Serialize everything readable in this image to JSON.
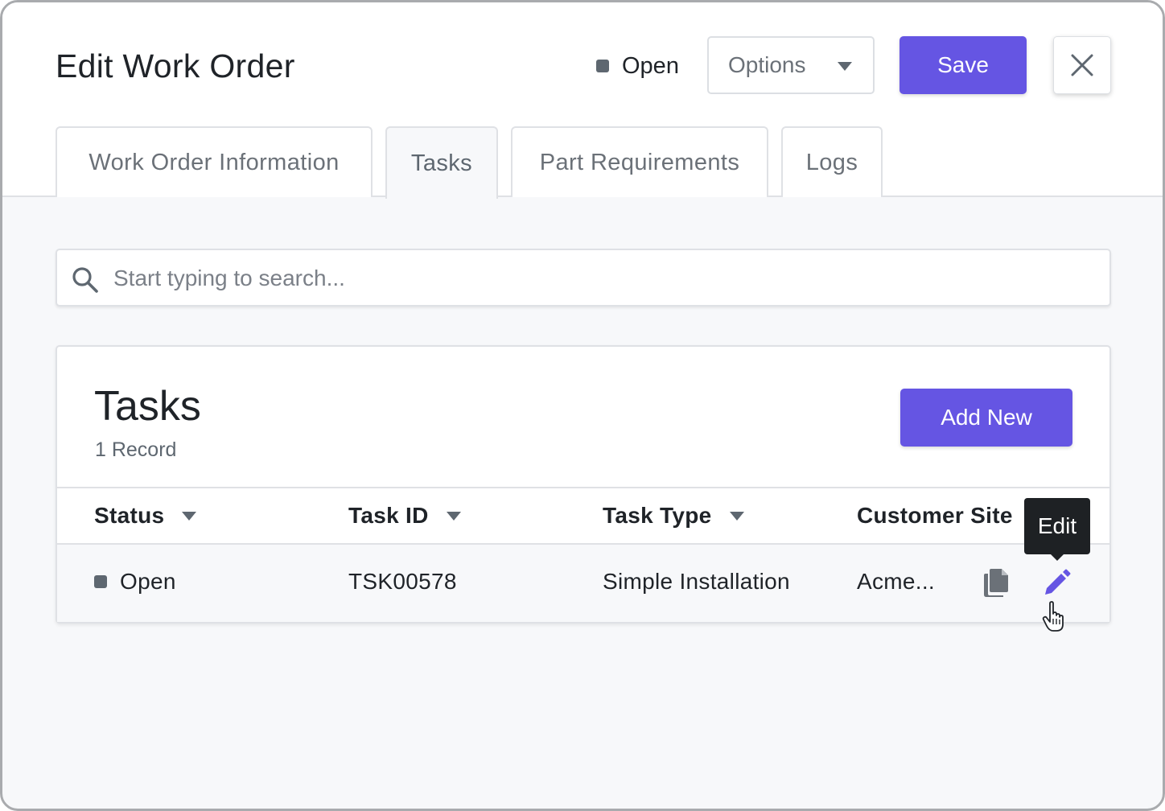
{
  "header": {
    "title": "Edit Work Order",
    "status": "Open",
    "options_label": "Options",
    "save_label": "Save"
  },
  "tabs": [
    {
      "label": "Work Order Information",
      "active": false
    },
    {
      "label": "Tasks",
      "active": true
    },
    {
      "label": "Part Requirements",
      "active": false
    },
    {
      "label": "Logs",
      "active": false
    }
  ],
  "search": {
    "placeholder": "Start typing to search..."
  },
  "tasks_panel": {
    "title": "Tasks",
    "record_count": "1 Record",
    "add_new_label": "Add New",
    "columns": [
      "Status",
      "Task ID",
      "Task Type",
      "Customer Site"
    ],
    "rows": [
      {
        "status": "Open",
        "task_id": "TSK00578",
        "task_type": "Simple Installation",
        "customer_site": "Acme..."
      }
    ],
    "tooltip": "Edit"
  },
  "colors": {
    "accent": "#6555e3",
    "status_square": "#5e6770",
    "tooltip_bg": "#1e2124"
  },
  "icons": [
    "chevron-down-icon",
    "close-icon",
    "search-icon",
    "copy-icon",
    "pencil-icon",
    "hand-pointer-icon"
  ]
}
